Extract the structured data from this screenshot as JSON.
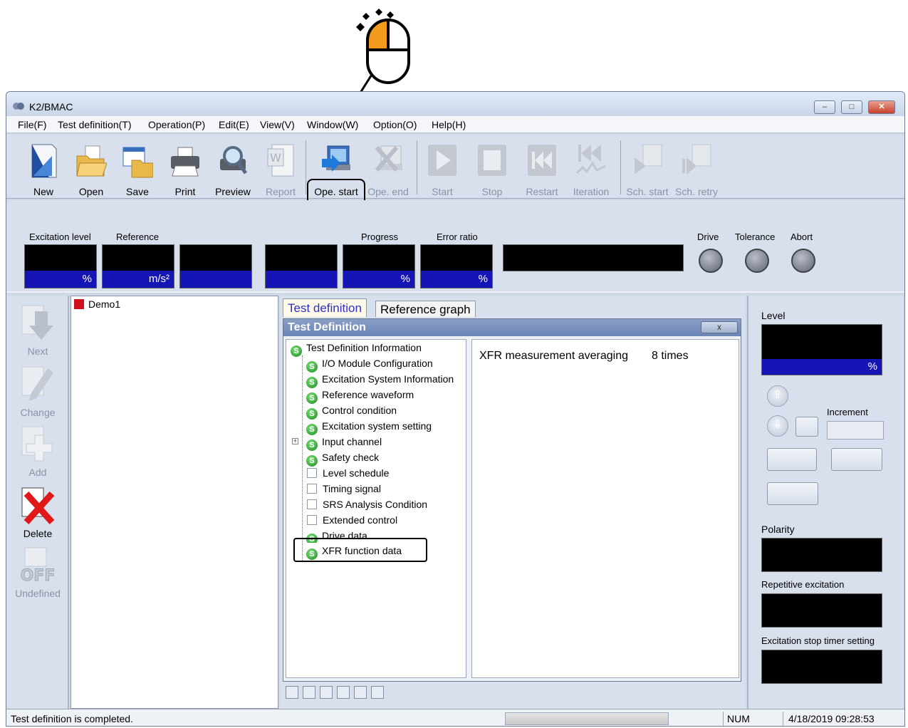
{
  "window": {
    "title": "K2/BMAC",
    "minimize": "–",
    "maximize": "□",
    "close": "✕"
  },
  "menu": [
    "File(F)",
    "Test definition(T)",
    "Operation(P)",
    "Edit(E)",
    "View(V)",
    "Window(W)",
    "Option(O)",
    "Help(H)"
  ],
  "toolbar": {
    "buttons": [
      {
        "label": "New",
        "icon": "new-document-icon",
        "enabled": true
      },
      {
        "label": "Open",
        "icon": "open-folder-icon",
        "enabled": true
      },
      {
        "label": "Save",
        "icon": "save-folder-icon",
        "enabled": true
      },
      {
        "label": "Print",
        "icon": "printer-icon",
        "enabled": true
      },
      {
        "label": "Preview",
        "icon": "magnifier-preview-icon",
        "enabled": true
      },
      {
        "label": "Report",
        "icon": "word-report-icon",
        "enabled": false
      },
      {
        "label": "Ope. start",
        "icon": "operation-start-icon",
        "enabled": true
      },
      {
        "label": "Ope. end",
        "icon": "operation-end-icon",
        "enabled": false
      },
      {
        "label": "Start",
        "icon": "play-icon",
        "enabled": false
      },
      {
        "label": "Stop",
        "icon": "stop-icon",
        "enabled": false
      },
      {
        "label": "Restart",
        "icon": "rewind-icon",
        "enabled": false
      },
      {
        "label": "Iteration",
        "icon": "iteration-icon",
        "enabled": false
      },
      {
        "label": "Sch. start",
        "icon": "schedule-start-icon",
        "enabled": false
      },
      {
        "label": "Sch. retry",
        "icon": "schedule-retry-icon",
        "enabled": false
      }
    ]
  },
  "status_panel": {
    "excitation_level_label": "Excitation level",
    "reference_label": "Reference",
    "progress_label": "Progress",
    "error_ratio_label": "Error ratio",
    "drive_label": "Drive",
    "tolerance_label": "Tolerance",
    "abort_label": "Abort",
    "unit_percent": "%",
    "unit_ms2": "m/s²"
  },
  "left_toolbar": [
    {
      "label": "Next",
      "icon": "next-arrow-icon",
      "enabled": false
    },
    {
      "label": "Change",
      "icon": "pencil-icon",
      "enabled": false
    },
    {
      "label": "Add",
      "icon": "add-plus-icon",
      "enabled": false
    },
    {
      "label": "Delete",
      "icon": "delete-x-icon",
      "enabled": true
    },
    {
      "label": "Undefined",
      "icon": "off-icon",
      "enabled": false
    }
  ],
  "tree": {
    "root": "Demo1"
  },
  "tabs": {
    "test_definition": "Test definition",
    "reference_graph": "Reference graph"
  },
  "test_definition": {
    "title": "Test Definition",
    "close_label": "x",
    "items": [
      {
        "label": "Test Definition Information",
        "type": "s"
      },
      {
        "label": "I/O Module Configuration",
        "type": "s"
      },
      {
        "label": "Excitation System Information",
        "type": "s"
      },
      {
        "label": "Reference waveform",
        "type": "s"
      },
      {
        "label": "Control condition",
        "type": "s"
      },
      {
        "label": "Excitation system setting",
        "type": "s"
      },
      {
        "label": "Input channel",
        "type": "s"
      },
      {
        "label": "Safety check",
        "type": "s"
      },
      {
        "label": "Level schedule",
        "type": "box"
      },
      {
        "label": "Timing signal",
        "type": "box"
      },
      {
        "label": "SRS Analysis Condition",
        "type": "box"
      },
      {
        "label": "Extended control",
        "type": "box"
      },
      {
        "label": "Drive data",
        "type": "s"
      },
      {
        "label": "XFR function data",
        "type": "s"
      }
    ],
    "detail_label": "XFR measurement averaging",
    "detail_value": "8 times"
  },
  "right_panel": {
    "level_label": "Level",
    "level_unit": "%",
    "increment_label": "Increment",
    "polarity_label": "Polarity",
    "repetitive_label": "Repetitive excitation",
    "stop_timer_label": "Excitation stop timer setting"
  },
  "statusbar": {
    "message": "Test definition is completed.",
    "num": "NUM",
    "datetime": "4/18/2019  09:28:53"
  },
  "colors": {
    "accent_blue": "#1515b5",
    "highlight_orange": "#f39a1c",
    "delete_red": "#e01818",
    "s_icon_green": "#1a8a1a"
  }
}
